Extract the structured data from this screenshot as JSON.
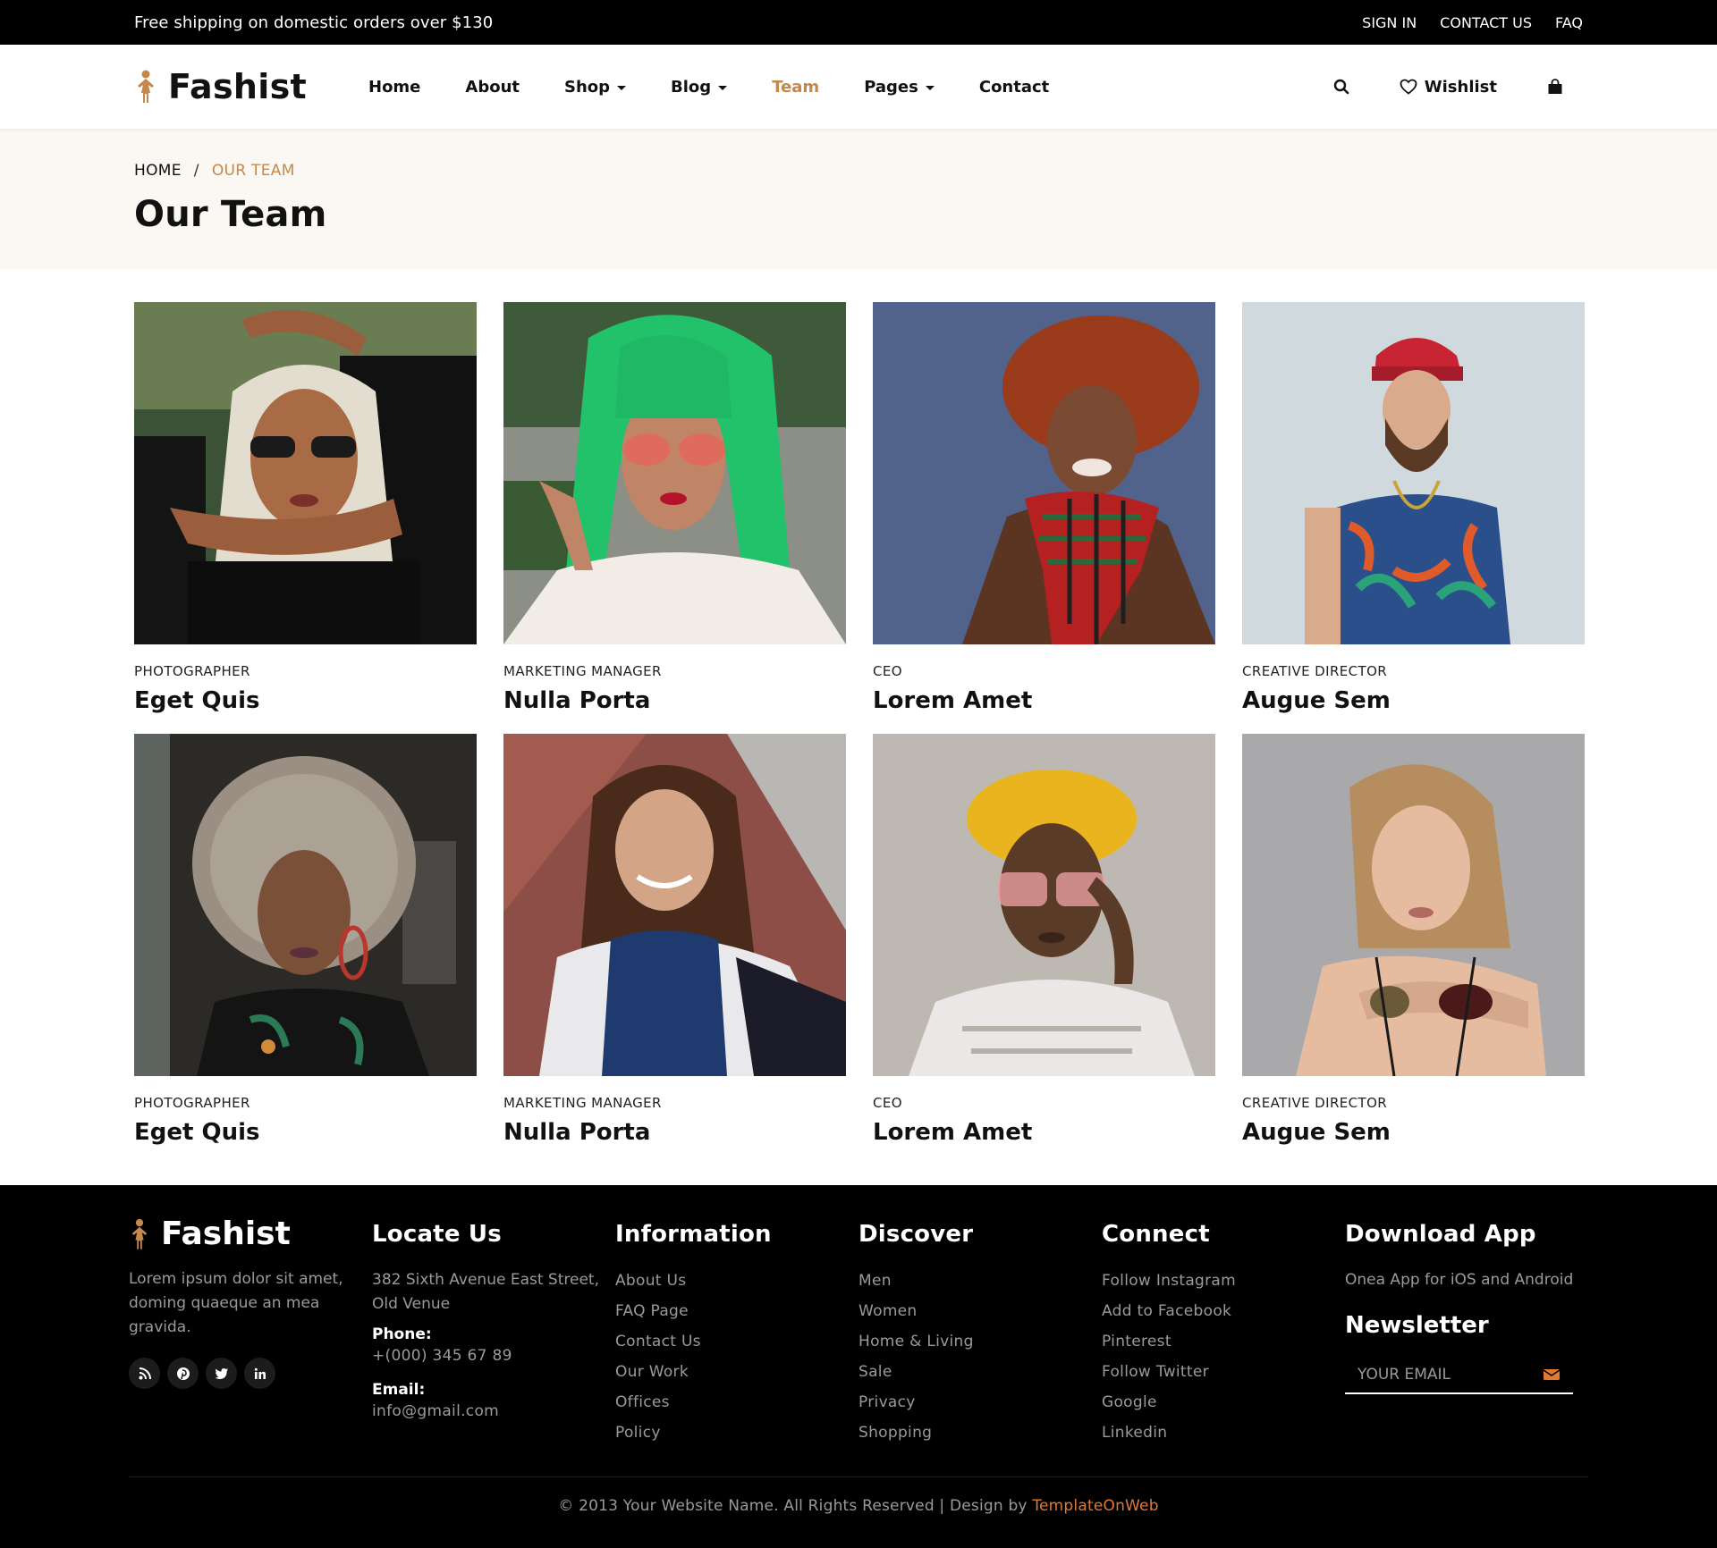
{
  "topbar": {
    "promo": "Free shipping on domestic orders over $130",
    "links": [
      "SIGN IN",
      "CONTACT US",
      "FAQ"
    ]
  },
  "header": {
    "logo": "Fashist",
    "nav": [
      {
        "label": "Home",
        "dropdown": false,
        "active": false
      },
      {
        "label": "About",
        "dropdown": false,
        "active": false
      },
      {
        "label": "Shop",
        "dropdown": true,
        "active": false
      },
      {
        "label": "Blog",
        "dropdown": true,
        "active": false
      },
      {
        "label": "Team",
        "dropdown": false,
        "active": true
      },
      {
        "label": "Pages",
        "dropdown": true,
        "active": false
      },
      {
        "label": "Contact",
        "dropdown": false,
        "active": false
      }
    ],
    "wishlist": "Wishlist",
    "icons": [
      "search-icon",
      "heart-icon",
      "shopping-bag-icon"
    ]
  },
  "pagehead": {
    "breadcrumb": [
      "HOME",
      "/",
      "OUR TEAM"
    ],
    "title": "Our Team"
  },
  "team": [
    {
      "role": "PHOTOGRAPHER",
      "name": "Eget Quis"
    },
    {
      "role": "MARKETING MANAGER",
      "name": "Nulla Porta"
    },
    {
      "role": "CEO",
      "name": "Lorem Amet"
    },
    {
      "role": "CREATIVE DIRECTOR",
      "name": "Augue Sem"
    },
    {
      "role": "PHOTOGRAPHER",
      "name": "Eget Quis"
    },
    {
      "role": "MARKETING MANAGER",
      "name": "Nulla Porta"
    },
    {
      "role": "CEO",
      "name": "Lorem Amet"
    },
    {
      "role": "CREATIVE DIRECTOR",
      "name": "Augue Sem"
    }
  ],
  "footer": {
    "logo": "Fashist",
    "description": "Lorem ipsum dolor sit amet, doming quaeque an mea gravida.",
    "social": [
      "rss-icon",
      "pinterest-icon",
      "twitter-icon",
      "linkedin-icon"
    ],
    "locate": {
      "title": "Locate Us",
      "address": "382 Sixth Avenue East Street, Old Venue",
      "phone_label": "Phone:",
      "phone": "+(000) 345 67 89",
      "email_label": "Email:",
      "email": "info@gmail.com"
    },
    "information": {
      "title": "Information",
      "links": [
        "About Us",
        "FAQ Page",
        "Contact Us",
        "Our Work",
        "Offices",
        "Policy"
      ]
    },
    "discover": {
      "title": "Discover",
      "links": [
        "Men",
        "Women",
        "Home & Living",
        "Sale",
        "Privacy",
        "Shopping"
      ]
    },
    "connect": {
      "title": "Connect",
      "links": [
        "Follow Instagram",
        "Add to Facebook",
        "Pinterest",
        "Follow Twitter",
        "Google",
        "Linkedin"
      ]
    },
    "app": {
      "title": "Download App",
      "description": "Onea App for iOS and Android",
      "newsletter_title": "Newsletter",
      "email_placeholder": "YOUR EMAIL"
    },
    "copyright": "© 2013 Your Website Name. All Rights Reserved | Design by",
    "copyright_brand": "TemplateOnWeb"
  },
  "colors": {
    "accent": "#c4874c",
    "brand_link": "#e07a33",
    "pagehead_bg": "#fbf8f3",
    "footer_bg": "#000000"
  }
}
